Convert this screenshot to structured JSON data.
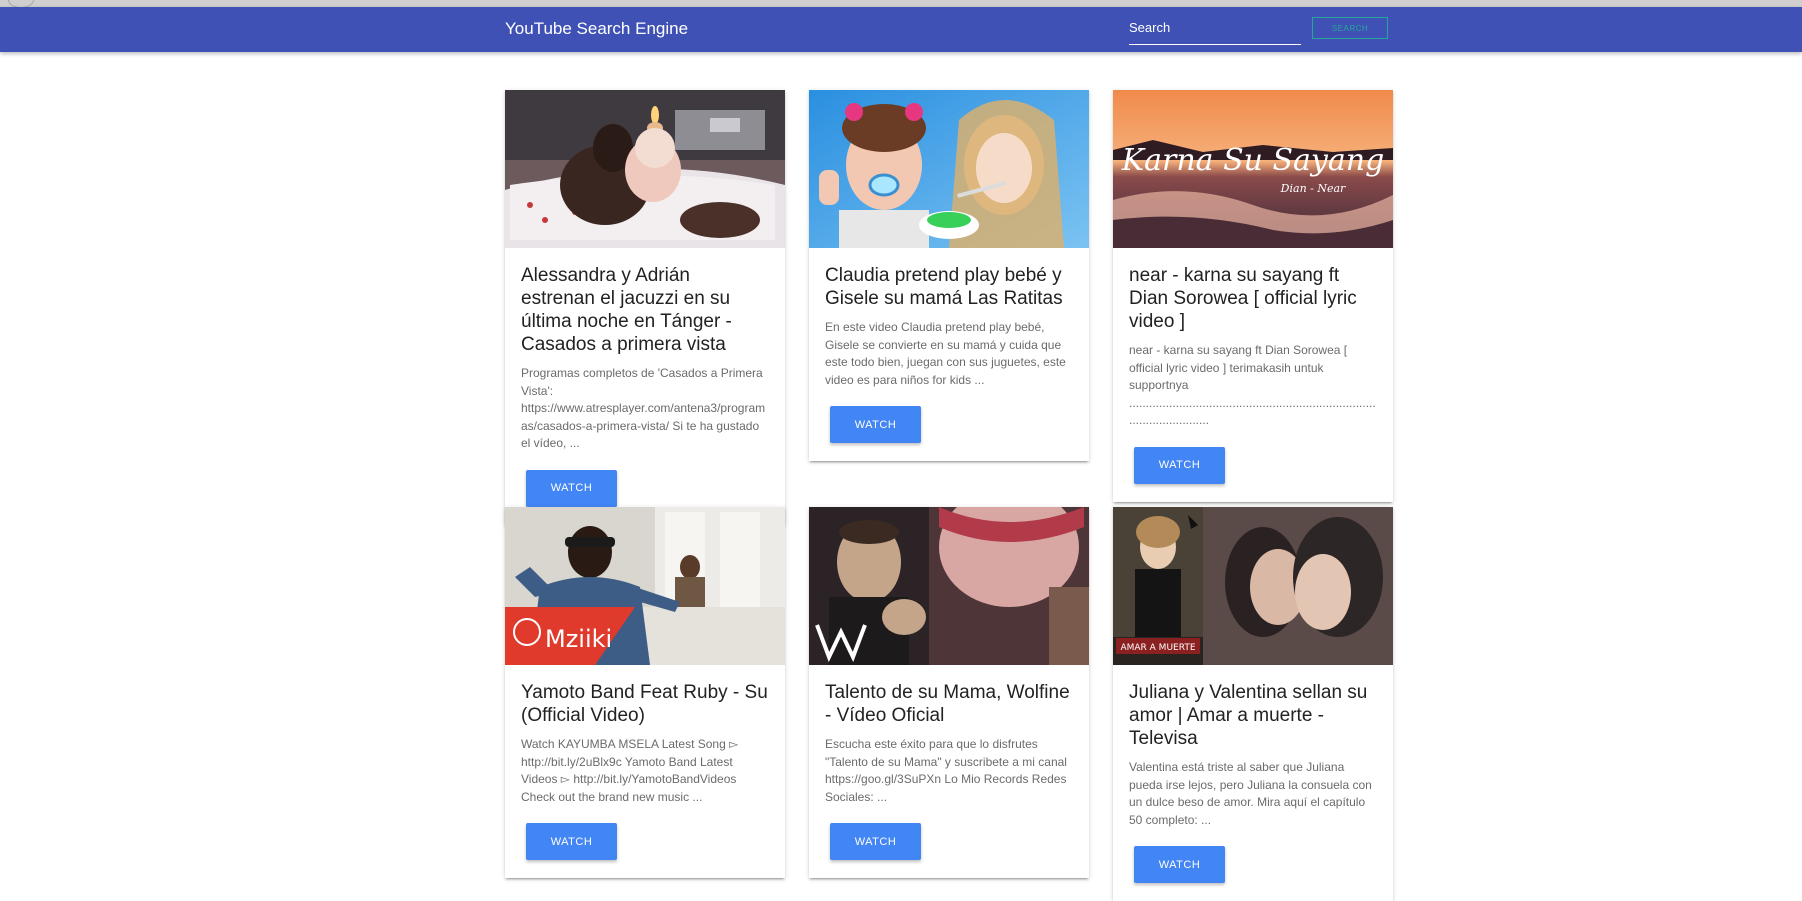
{
  "navbar": {
    "brand": "YouTube Search Engine",
    "search_placeholder": "Search",
    "search_button": "SEARCH",
    "color": "#3f51b5"
  },
  "watch_label": "WATCH",
  "videos": [
    {
      "title": "Alessandra y Adrián estrenan el jacuzzi en su última noche en Tánger - Casados a primera vista",
      "description": "Programas completos de 'Casados a Primera Vista': https://www.atresplayer.com/antena3/programas/casados-a-primera-vista/ Si te ha gustado el vídeo, ..."
    },
    {
      "title": "Claudia pretend play bebé y Gisele su mamá Las Ratitas",
      "description": "En este video Claudia pretend play bebé, Gisele se convierte en su mamá y cuida que este todo bien, juegan con sus juguetes, este video es para niños for kids ..."
    },
    {
      "title": "near - karna su sayang ft Dian Sorowea [ official lyric video ]",
      "description": "near - karna su sayang ft Dian Sorowea [ official lyric video ] terimakasih untuk supportnya ..................................................................................................",
      "thumb_text": "Karna Su Sayang",
      "thumb_subtext": "Dian - Near"
    },
    {
      "title": "Yamoto Band Feat Ruby - Su (Official Video)",
      "description": "Watch KAYUMBA MSELA Latest Song ▻ http://bit.ly/2uBlx9c Yamoto Band Latest Videos ▻ http://bit.ly/YamotoBandVideos Check out the brand new music ...",
      "thumb_text": "Mziiki"
    },
    {
      "title": "Talento de su Mama, Wolfine - Vídeo Oficial",
      "description": "Escucha este éxito para que lo disfrutes \"Talento de su Mama\" y suscribete a mi canal https://goo.gl/3SuPXn Lo Mio Records Redes Sociales: ..."
    },
    {
      "title": "Juliana y Valentina sellan su amor | Amar a muerte - Televisa",
      "description": "Valentina está triste al saber que Juliana pueda irse lejos, pero Juliana la consuela con un dulce beso de amor. Mira aquí el capítulo 50 completo: ...",
      "thumb_text": "AMAR A MUERTE"
    }
  ]
}
